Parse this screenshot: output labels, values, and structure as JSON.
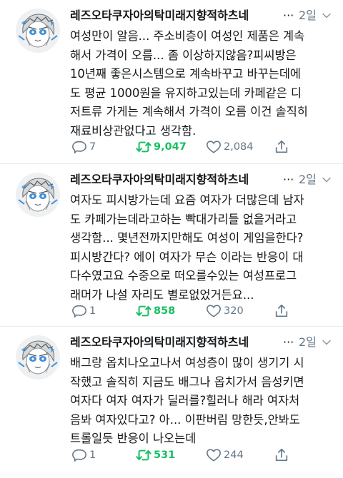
{
  "colors": {
    "retweet": "#17bf63",
    "muted": "#657786",
    "text": "#14171a",
    "divider": "#e6ecf0"
  },
  "tweets": [
    {
      "name": "레즈오타쿠자아의탁미래지향적하츠네",
      "ellipsis": "···",
      "time": "2일",
      "text": "여성만이 알음... 주소비층이 여성인 제품은 계속\n해서 가격이 오름... 좀 이상하지않음?피씨방은\n10년째 좋은시스템으로 계속바꾸고 바꾸는데에\n도 평균 1000원을 유지하고있는데 카페같은 디\n저트류 가게는 계속해서 가격이 오름 이건 솔직히\n재료비상관없다고 생각함.",
      "replies": "7",
      "retweets": "9,047",
      "likes": "2,084",
      "icons": [
        "reply-icon",
        "retweet-icon",
        "like-icon",
        "share-icon"
      ]
    },
    {
      "name": "레즈오타쿠자아의탁미래지향적하츠네",
      "ellipsis": "···",
      "time": "2일",
      "text": "여자도 피시방가는데 요즘 여자가 더많은데 남자\n도 카페가는데라고하는 빡대가리들 없을거라고\n생각함... 몇년전까지만해도 여성이 게임을한다?\n피시방간다? 에이 여자가 무슨 이라는 반응이 대\n다수였고요 수중으로 떠오를수있는 여성프로그\n래머가 나설 자리도 별로없었거든요...",
      "replies": "1",
      "retweets": "858",
      "likes": "320",
      "icons": [
        "reply-icon",
        "retweet-icon",
        "like-icon",
        "share-icon"
      ]
    },
    {
      "name": "레즈오타쿠자아의탁미래지향적하츠네",
      "ellipsis": "···",
      "time": "2일",
      "text": "배그랑 옵치나오고나서 여성층이 많이 생기기 시\n작했고 솔직히 지금도 배그나 옵치가서 음성키면\n여자다 여자 여자가 딜러를?힐러나 해라 여자처\n음봐 여자있다고? 아... 이판버림 망한듯,안봐도\n트롤일듯 반응이 나오는데",
      "replies": "1",
      "retweets": "531",
      "likes": "244",
      "icons": [
        "reply-icon",
        "retweet-icon",
        "like-icon",
        "share-icon"
      ]
    }
  ]
}
